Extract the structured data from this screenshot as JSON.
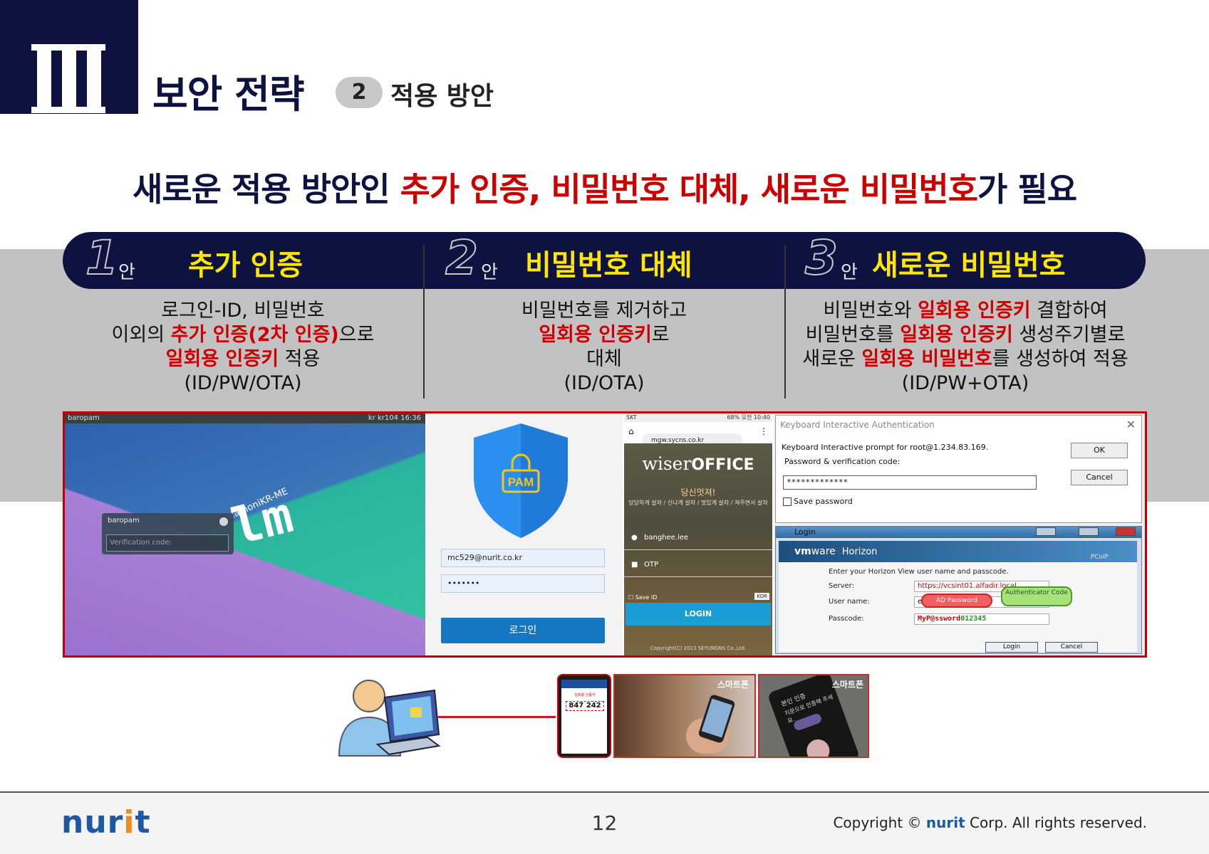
{
  "header": {
    "section_numeral": "III",
    "title": "보안 전략",
    "step_number": "2",
    "step_label": "적용 방안"
  },
  "headline": {
    "part1": "새로운 적용 방안인 ",
    "part2": "추가 인증, 비밀번호 대체, 새로운 비밀번호",
    "part3": "가 필요"
  },
  "columns": [
    {
      "num": "1",
      "an": "안",
      "title": "추가 인증",
      "desc": [
        [
          {
            "t": "로그인-ID, 비밀번호",
            "r": false
          }
        ],
        [
          {
            "t": "이외의 ",
            "r": false
          },
          {
            "t": "추가 인증(2차 인증)",
            "r": true
          },
          {
            "t": "으로",
            "r": false
          }
        ],
        [
          {
            "t": "일회용 인증키",
            "r": true
          },
          {
            "t": " 적용",
            "r": false
          }
        ],
        [
          {
            "t": "(ID/PW/OTA)",
            "r": false
          }
        ]
      ]
    },
    {
      "num": "2",
      "an": "안",
      "title": "비밀번호 대체",
      "desc": [
        [
          {
            "t": "비밀번호를 제거하고",
            "r": false
          }
        ],
        [
          {
            "t": "일회용 인증키",
            "r": true
          },
          {
            "t": "로",
            "r": false
          }
        ],
        [
          {
            "t": "대체",
            "r": false
          }
        ],
        [
          {
            "t": "(ID/OTA)",
            "r": false
          }
        ]
      ]
    },
    {
      "num": "3",
      "an": "안",
      "title": "새로운 비밀번호",
      "desc": [
        [
          {
            "t": "비밀번호와 ",
            "r": false
          },
          {
            "t": "일회용 인증키",
            "r": true
          },
          {
            "t": " 결합하여",
            "r": false
          }
        ],
        [
          {
            "t": "비밀번호를 ",
            "r": false
          },
          {
            "t": "일회용 인증키",
            "r": true
          },
          {
            "t": " 생성주기별로",
            "r": false
          }
        ],
        [
          {
            "t": "새로운 ",
            "r": false
          },
          {
            "t": "일회용 비밀번호",
            "r": true
          },
          {
            "t": "를 생성하여 적용",
            "r": false
          }
        ],
        [
          {
            "t": "(ID/PW+OTA)",
            "r": false
          }
        ]
      ]
    }
  ],
  "panel_mint": {
    "topbar_left": "baropam",
    "topbar_right": "kr  kr104  16:36",
    "login_user": "baropam",
    "verification_placeholder": "Verification code:",
    "logo_text": "lm",
    "hamoni": "HamoniKR-ME"
  },
  "panel_pam": {
    "shield_label": "PAM",
    "email": "mc529@nurit.co.kr",
    "password": "•••••••",
    "login_button": "로그인"
  },
  "panel_wiser": {
    "status_left": "SKT",
    "status_right": "68% 오전 10:40",
    "url": "mgw.sycns.co.kr",
    "logo_light": "wiser",
    "logo_bold": "OFFICE",
    "tagline": "당신멋져!",
    "tagline_sub": "당당하게 살자 / 신나게 살자 / 멋있게 살자 / 져주면서 살자",
    "user_field": "banghee.lee",
    "otp_field": "OTP",
    "save_id": "Save ID",
    "kor": "KOR",
    "login_button": "LOGIN",
    "copyright": "Copyright(C) 2013 SEYUNGNS Co.,Ltd."
  },
  "panel_kia": {
    "title": "Keyboard Interactive Authentication",
    "prompt": "Keyboard Interactive prompt for root@1.234.83.169.",
    "pw_label": "Password & verification code:",
    "pw_value": "*************",
    "ok": "OK",
    "cancel": "Cancel",
    "save_password": "Save password"
  },
  "panel_vmware": {
    "window_title": "Login",
    "brand_vm": "vm",
    "brand_ware": "ware",
    "brand_product": "Horizon",
    "pcoip": "PCoIP",
    "instruction": "Enter your Horizon View user name and passcode.",
    "server_label": "Server:",
    "server_value": "https://vcsint01.alfadir.local",
    "user_label": "User name:",
    "user_value": "eric",
    "passcode_label": "Passcode:",
    "passcode_value_a": "MyP@ssword",
    "passcode_value_b": "012345",
    "bubble_pw": "AD Password",
    "bubble_auth": "Authenticator Code",
    "login_button": "Login",
    "cancel_button": "Cancel"
  },
  "bottom_row": {
    "phone_otp": "847 242",
    "phone_header": "일회용 인증키",
    "phone_mid_label": "스마트폰",
    "phone_right_label": "스마트폰",
    "phone_right_text1": "본인 인증",
    "phone_right_text2": "지문으로 인증해 주세요."
  },
  "footer": {
    "brand_a": "nur",
    "brand_i": "i",
    "brand_b": "t",
    "page": "12",
    "copyright_pre": "Copyright © ",
    "copyright_brand": "nurit",
    "copyright_post": " Corp. All rights reserved."
  },
  "colors": {
    "navy": "#0d1240",
    "accent_red": "#cc0000",
    "highlight_yellow": "#ffe600",
    "band_gray": "#c2c2c2",
    "brand_blue": "#1d5aa3",
    "brand_orange": "#f08a1a"
  }
}
